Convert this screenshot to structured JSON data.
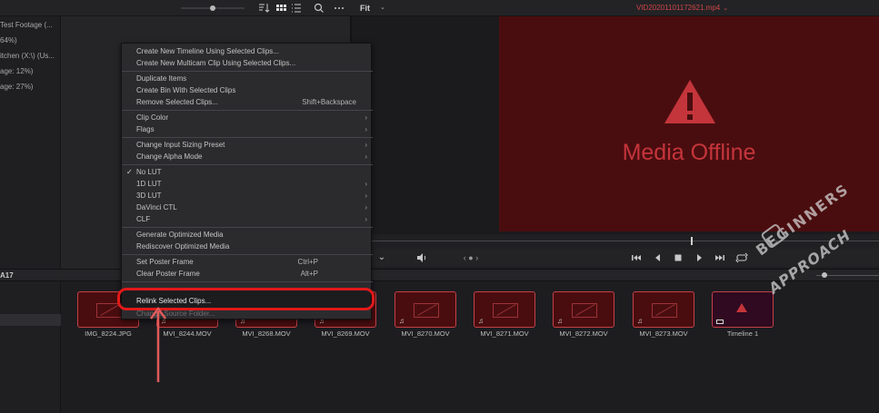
{
  "toolbar": {
    "sort_icon": "sort-icon",
    "grid_icon": "grid-view-icon",
    "list_icon": "list-view-icon",
    "search_icon": "search-icon",
    "more_icon": "more-icon",
    "fit_label": "Fit",
    "clip_title": "VID20201101172621.mp4"
  },
  "bins": [
    "Test Footage (...",
    "64%)",
    "itchen (X:\\) (Us...",
    "age: 12%)",
    "age: 27%)"
  ],
  "viewer": {
    "offline_text": "Media Offline",
    "accent": "#c4353b"
  },
  "section": {
    "label": "A17"
  },
  "context_menu": {
    "items": [
      {
        "label": "Create New Timeline Using Selected Clips..."
      },
      {
        "label": "Create New Multicam Clip Using Selected Clips..."
      },
      {
        "label": "Duplicate Items"
      },
      {
        "label": "Create Bin With Selected Clips"
      },
      {
        "label": "Remove Selected Clips...",
        "shortcut": "Shift+Backspace"
      },
      {
        "label": "Clip Color"
      },
      {
        "label": "Flags"
      },
      {
        "label": "Change Input Sizing Preset"
      },
      {
        "label": "Change Alpha Mode"
      },
      {
        "label": "No LUT"
      },
      {
        "label": "1D LUT"
      },
      {
        "label": "3D LUT"
      },
      {
        "label": "DaVinci CTL"
      },
      {
        "label": "CLF"
      },
      {
        "label": "Generate Optimized Media"
      },
      {
        "label": "Rediscover Optimized Media"
      },
      {
        "label": "Set Poster Frame",
        "shortcut": "Ctrl+P"
      },
      {
        "label": "Clear Poster Frame",
        "shortcut": "Alt+P"
      },
      {
        "label": "Relink Selected Clips..."
      },
      {
        "label": "Change Source Folder..."
      }
    ]
  },
  "clips": [
    {
      "name": "IMG_8224.JPG",
      "audio": false
    },
    {
      "name": "MVI_8244.MOV",
      "audio": true
    },
    {
      "name": "MVI_8268.MOV",
      "audio": true
    },
    {
      "name": "MVI_8269.MOV",
      "audio": true
    },
    {
      "name": "MVI_8270.MOV",
      "audio": true
    },
    {
      "name": "MVI_8271.MOV",
      "audio": true
    },
    {
      "name": "MVI_8272.MOV",
      "audio": true
    },
    {
      "name": "MVI_8273.MOV",
      "audio": true
    },
    {
      "name": "Timeline 1",
      "audio": false
    }
  ],
  "watermark": {
    "line1": "BEGINNERS",
    "line2": "APPROACH"
  },
  "colors": {
    "highlight": "#e01a1a",
    "offline_bg": "#4a0d0f",
    "clip_border": "#c44147"
  }
}
